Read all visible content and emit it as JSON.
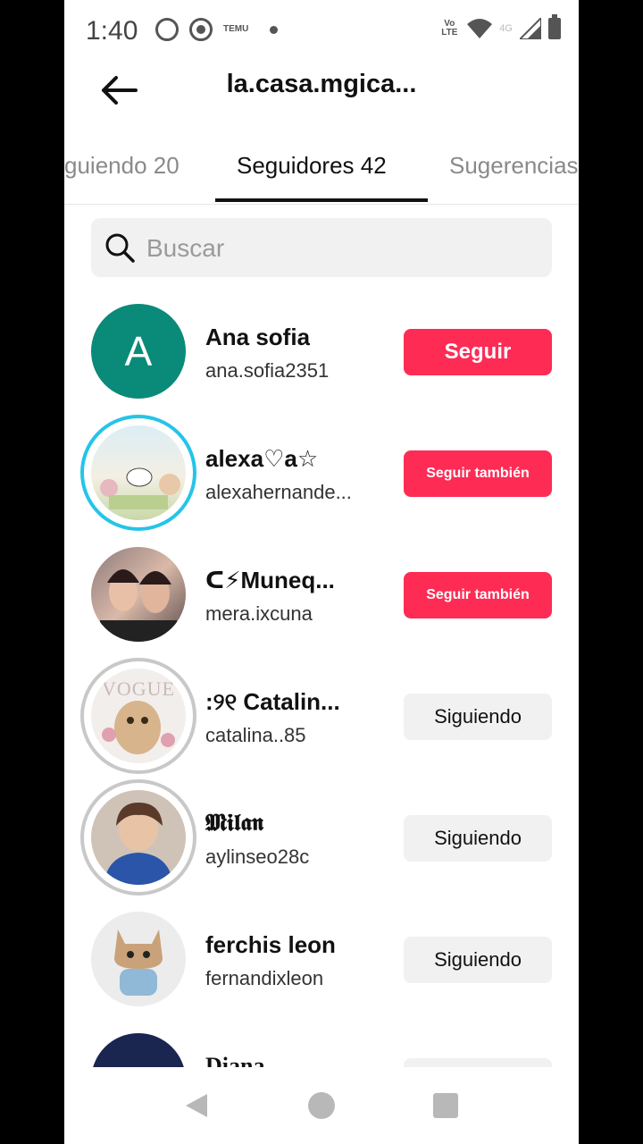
{
  "status_bar": {
    "time": "1:40",
    "temu_label": "TEMU",
    "volte_label": "Vo LTE",
    "network_label": "4G",
    "icons": [
      "whatsapp-icon",
      "record-icon",
      "temu-icon",
      "wifi-icon",
      "signal-icon",
      "battery-icon"
    ]
  },
  "header": {
    "title": "la.casa.mgica..."
  },
  "tabs": [
    {
      "label": "guiendo 20"
    },
    {
      "label": "Seguidores 42"
    },
    {
      "label": "Sugerencias"
    }
  ],
  "search": {
    "placeholder": "Buscar",
    "value": ""
  },
  "followers": [
    {
      "name": "Ana sofia",
      "handle": "ana.sofia2351",
      "button": "Seguir",
      "avatar_letter": "A",
      "button_style": "red-big"
    },
    {
      "name": "alexa♡a☆",
      "handle": "alexahernande...",
      "button": "Seguir también",
      "button_style": "red-small"
    },
    {
      "name": "ᑕ⚡Muneq...",
      "handle": "mera.ixcuna",
      "button": "Seguir también",
      "button_style": "red-small"
    },
    {
      "name": ":୨୧ Catalin...",
      "handle": "catalina..85",
      "button": "Siguiendo",
      "button_style": "grey",
      "avatar_text": "VOGUE"
    },
    {
      "name": "𝕸𝖎𝖑𝖆𝖓",
      "handle": "aylinseo28c",
      "button": "Siguiendo",
      "button_style": "grey"
    },
    {
      "name": "ferchis leon",
      "handle": "fernandixleon",
      "button": "Siguiendo",
      "button_style": "grey"
    },
    {
      "name": "Diana",
      "handle": "",
      "button": "",
      "button_style": "grey"
    }
  ],
  "colors": {
    "accent": "#fe2c55",
    "avatar_teal": "#0a8a78",
    "story_ring": "#25c4e8",
    "seen_ring": "#c8c8c8"
  }
}
